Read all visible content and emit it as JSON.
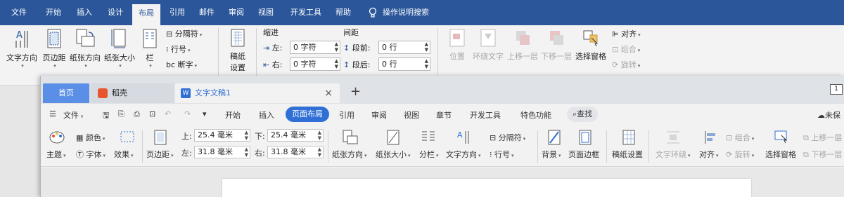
{
  "word": {
    "tabs": [
      "文件",
      "开始",
      "插入",
      "设计",
      "布局",
      "引用",
      "邮件",
      "审阅",
      "视图",
      "开发工具",
      "帮助"
    ],
    "active_tab": "布局",
    "tell_me": "操作说明搜索",
    "page_setup": {
      "text_direction": "文字方向",
      "margins": "页边距",
      "orientation": "纸张方向",
      "size": "纸张大小",
      "columns": "栏",
      "breaks": "分隔符",
      "line_numbers": "行号",
      "hyphenation": "断字"
    },
    "manuscript": {
      "line1": "稿纸",
      "line2": "设置"
    },
    "paragraph": {
      "indent_title": "缩进",
      "spacing_title": "间距",
      "left_label": "左:",
      "left_value": "0 字符",
      "right_label": "右:",
      "right_value": "0 字符",
      "before_label": "段前:",
      "before_value": "0 行",
      "after_label": "段后:",
      "after_value": "0 行"
    },
    "arrange": {
      "position": "位置",
      "wrap_text": "环绕文字",
      "bring_forward": "上移一层",
      "send_backward": "下移一层",
      "selection_pane": "选择窗格",
      "align": "对齐",
      "group": "组合",
      "rotate": "旋转"
    }
  },
  "wps": {
    "tabs": {
      "home": "首页",
      "daoke": "稻壳",
      "doc": "文字文稿1",
      "close": "×",
      "new": "+",
      "right_badge": "1"
    },
    "menu": {
      "file": "文件",
      "items": [
        "开始",
        "插入",
        "页面布局",
        "引用",
        "审阅",
        "视图",
        "章节",
        "开发工具",
        "特色功能"
      ],
      "active": "页面布局",
      "search": "查找",
      "unsaved": "未保"
    },
    "ribbon": {
      "theme": "主题",
      "colors": "颜色",
      "fonts": "字体",
      "effects": "效果",
      "margins": "页边距",
      "top_label": "上:",
      "top_value": "25.4 毫米",
      "bottom_label": "下:",
      "bottom_value": "25.4 毫米",
      "left_label": "左:",
      "left_value": "31.8 毫米",
      "right_label": "右:",
      "right_value": "31.8 毫米",
      "orientation": "纸张方向",
      "size": "纸张大小",
      "columns": "分栏",
      "text_direction": "文字方向",
      "breaks": "分隔符",
      "line_numbers": "行号",
      "background": "背景",
      "page_border": "页面边框",
      "manuscript": "稿纸设置",
      "wrap_text": "文字环绕",
      "align": "对齐",
      "group": "组合",
      "rotate": "旋转",
      "selection_pane": "选择窗格",
      "bring_forward": "上移一层",
      "send_backward": "下移一层"
    }
  },
  "colors": {
    "word_blue": "#2b579a",
    "wps_active": "#2f6fd6",
    "wps_home_tab": "#5b8ee6"
  }
}
